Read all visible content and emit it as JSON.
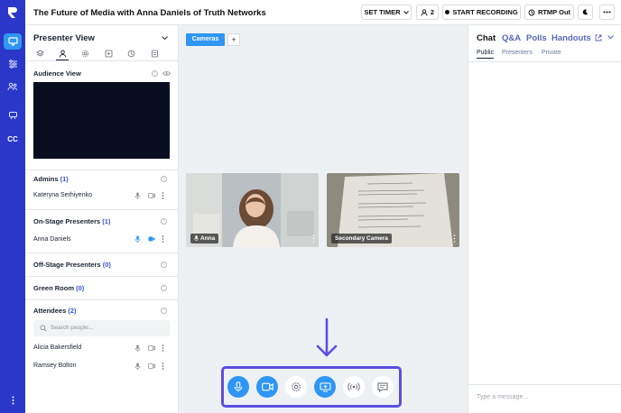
{
  "app": {
    "title": "The Future of Media with Anna Daniels of Truth Networks",
    "brand_color": "#2b37c9",
    "accent_color": "#2f96f3",
    "annotation_color": "#5b4fe0"
  },
  "rail": {
    "items": [
      {
        "icon": "monitor-icon",
        "active": true
      },
      {
        "icon": "sliders-icon",
        "active": false
      },
      {
        "icon": "people-icon",
        "active": false
      },
      {
        "icon": "projector-icon",
        "active": false
      },
      {
        "icon": "cc-icon",
        "label": "CC",
        "active": false
      }
    ]
  },
  "topbar": {
    "set_timer": "SET TIMER",
    "attendee_count": "2",
    "start_recording": "START RECORDING",
    "rtmp_out": "RTMP Out"
  },
  "presenter": {
    "title": "Presenter View",
    "audience_view": "Audience View",
    "sections": {
      "admins": {
        "title": "Admins",
        "count": "(1)"
      },
      "onstage": {
        "title": "On-Stage Presenters",
        "count": "(1)"
      },
      "offstage": {
        "title": "Off-Stage Presenters",
        "count": "(0)"
      },
      "greenroom": {
        "title": "Green Room",
        "count": "(0)"
      },
      "attendees": {
        "title": "Attendees",
        "count": "(2)"
      }
    },
    "admin_people": [
      "Kateryna Serhiyenko"
    ],
    "onstage_people": [
      "Anna Daniels"
    ],
    "search_placeholder": "Search people...",
    "attendee_people": [
      "Alicia Bakersfield",
      "Ramsey Bolton"
    ]
  },
  "stage": {
    "tab": "Cameras",
    "add_tab": "+",
    "cameras": [
      {
        "label": "Anna"
      },
      {
        "label": "Secondary Camera"
      }
    ]
  },
  "chat": {
    "tabs": [
      "Chat",
      "Q&A",
      "Polls",
      "Handouts"
    ],
    "subtabs": [
      "Public",
      "Presenters",
      "Private"
    ],
    "input_placeholder": "Type a message..."
  }
}
